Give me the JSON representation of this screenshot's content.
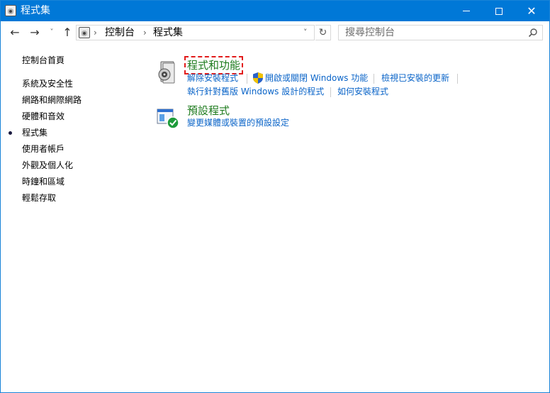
{
  "window": {
    "title": "程式集",
    "controls": {
      "minimize": "minimize-icon",
      "maximize": "maximize-icon",
      "close": "close-icon"
    }
  },
  "nav": {
    "back_icon": "←",
    "forward_icon": "→",
    "recent_icon": "˅",
    "up_icon": "↑"
  },
  "address": {
    "breadcrumb": [
      "控制台",
      "程式集"
    ],
    "separator": "›",
    "dropdown_icon": "˅",
    "refresh_icon": "↻"
  },
  "search": {
    "placeholder": "搜尋控制台"
  },
  "sidebar": {
    "items": [
      {
        "label": "控制台首頁",
        "current": false
      },
      {
        "label": "系統及安全性",
        "current": false
      },
      {
        "label": "網路和網際網路",
        "current": false
      },
      {
        "label": "硬體和音效",
        "current": false
      },
      {
        "label": "程式集",
        "current": true
      },
      {
        "label": "使用者帳戶",
        "current": false
      },
      {
        "label": "外觀及個人化",
        "current": false
      },
      {
        "label": "時鐘和區域",
        "current": false
      },
      {
        "label": "輕鬆存取",
        "current": false
      }
    ]
  },
  "main": {
    "categories": [
      {
        "title": "程式和功能",
        "icon": "programs-features-icon",
        "highlighted": true,
        "tasks": [
          {
            "label": "解除安裝程式"
          },
          {
            "label": "開啟或關閉 Windows 功能",
            "shield": true
          },
          {
            "label": "檢視已安裝的更新"
          },
          {
            "label": "執行針對舊版 Windows 設計的程式"
          },
          {
            "label": "如何安裝程式"
          }
        ]
      },
      {
        "title": "預設程式",
        "icon": "default-programs-icon",
        "highlighted": false,
        "tasks": [
          {
            "label": "變更媒體或裝置的預設設定"
          }
        ]
      }
    ]
  },
  "colors": {
    "titlebar": "#0078d7",
    "category_title": "#1e7b1e",
    "link": "#0a64c8",
    "highlight_outline": "#e21b1b"
  }
}
